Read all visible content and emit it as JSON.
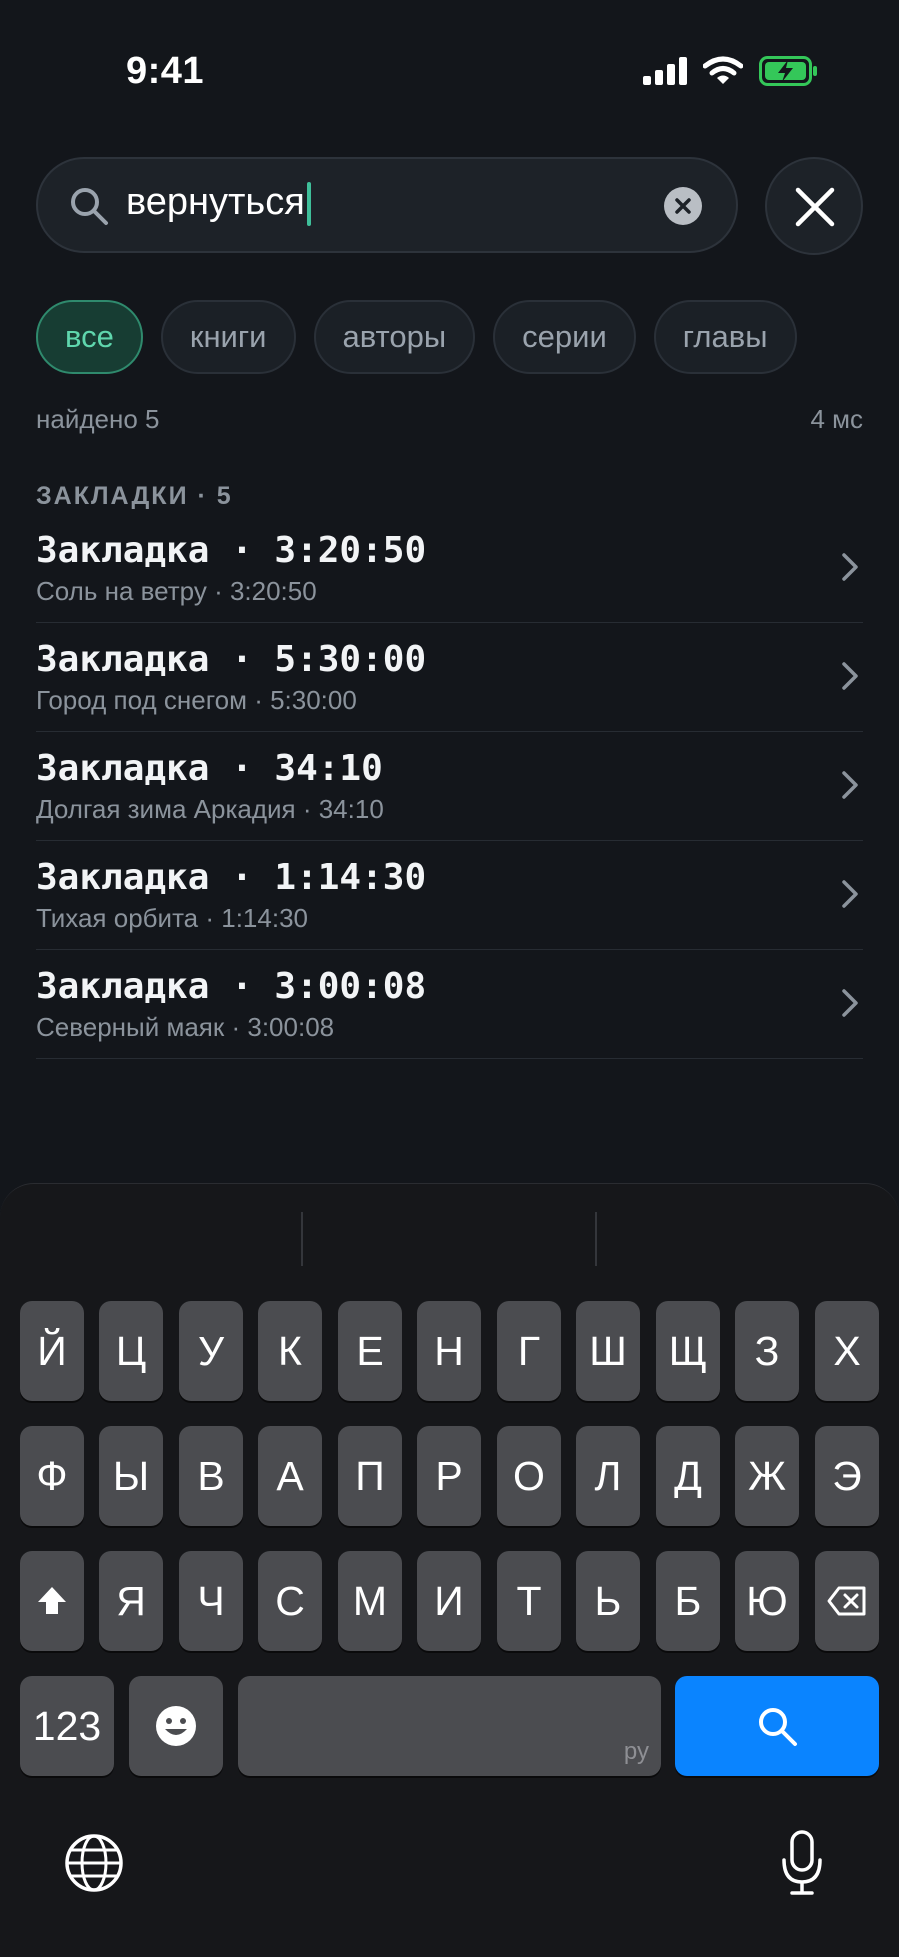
{
  "status": {
    "time": "9:41"
  },
  "search": {
    "query": "вернуться"
  },
  "filters": [
    "все",
    "книги",
    "авторы",
    "серии",
    "главы"
  ],
  "meta": {
    "found": "найдено 5",
    "duration": "4 мс"
  },
  "section": {
    "title": "ЗАКЛАДКИ · 5"
  },
  "results": [
    {
      "title": "Закладка · 3:20:50",
      "subtitle": "Соль на ветру · 3:20:50"
    },
    {
      "title": "Закладка · 5:30:00",
      "subtitle": "Город под снегом · 5:30:00"
    },
    {
      "title": "Закладка · 34:10",
      "subtitle": "Долгая зима Аркадия · 34:10"
    },
    {
      "title": "Закладка · 1:14:30",
      "subtitle": "Тихая орбита · 1:14:30"
    },
    {
      "title": "Закладка · 3:00:08",
      "subtitle": "Северный маяк · 3:00:08"
    }
  ],
  "keyboard": {
    "row1": [
      "Й",
      "Ц",
      "У",
      "К",
      "Е",
      "Н",
      "Г",
      "Ш",
      "Щ",
      "З",
      "Х"
    ],
    "row2": [
      "Ф",
      "Ы",
      "В",
      "А",
      "П",
      "Р",
      "О",
      "Л",
      "Д",
      "Ж",
      "Э"
    ],
    "row3": [
      "Я",
      "Ч",
      "С",
      "М",
      "И",
      "Т",
      "Ь",
      "Б",
      "Ю"
    ],
    "numbers_label": "123",
    "space_lang": "ру"
  },
  "colors": {
    "accent": "#5fd6ad",
    "caret": "#3fbf9a",
    "search_key": "#0a84ff",
    "battery": "#34c759"
  }
}
